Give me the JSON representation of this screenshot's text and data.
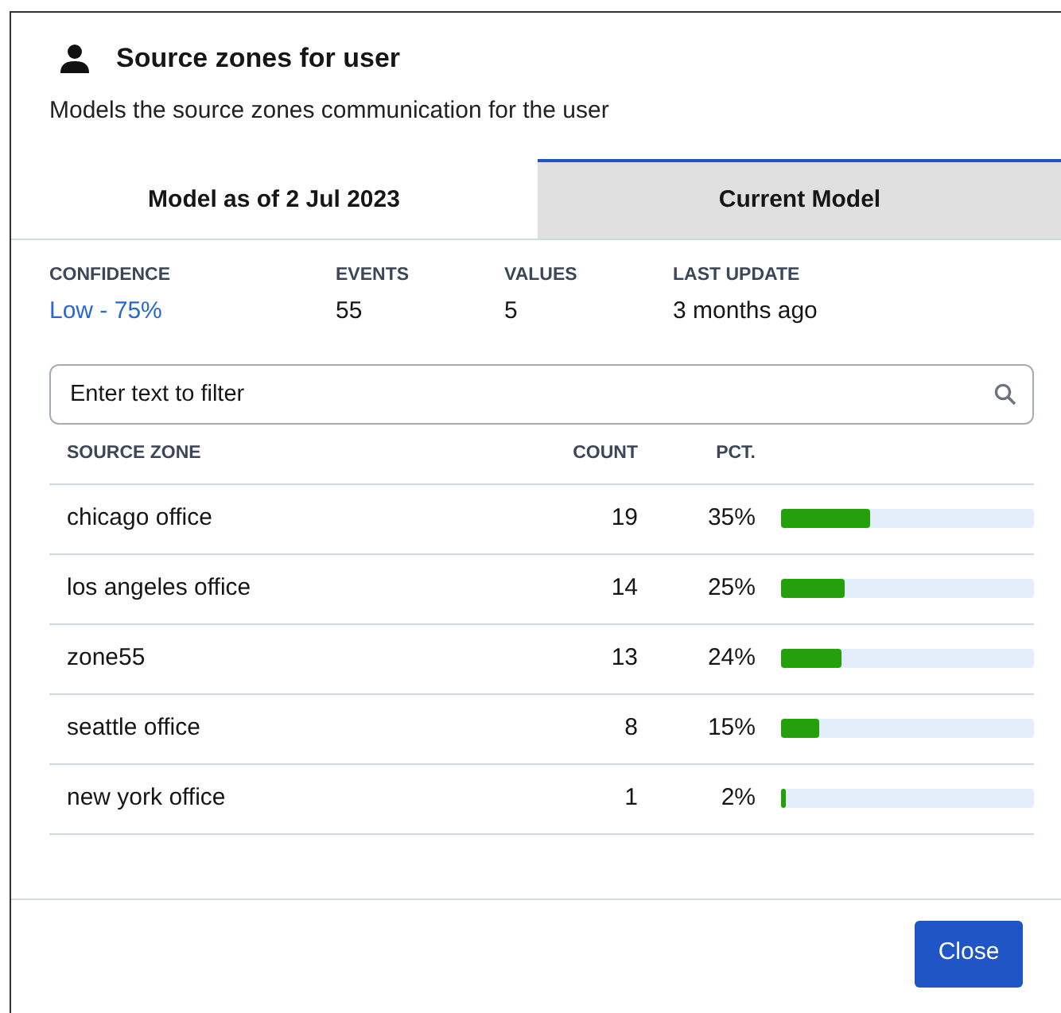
{
  "dialog": {
    "title": "Source zones for user",
    "description": "Models the source zones communication for the user"
  },
  "tabs": [
    {
      "label": "Model as of 2 Jul 2023",
      "selected": false
    },
    {
      "label": "Current Model",
      "selected": true
    }
  ],
  "stats": [
    {
      "label": "CONFIDENCE",
      "value": "Low - 75%",
      "kind": "link"
    },
    {
      "label": "EVENTS",
      "value": "55",
      "kind": "plain"
    },
    {
      "label": "VALUES",
      "value": "5",
      "kind": "plain"
    },
    {
      "label": "LAST UPDATE",
      "value": "3 months ago",
      "kind": "plain"
    }
  ],
  "filter": {
    "placeholder": "Enter text to filter"
  },
  "table": {
    "columns": [
      "SOURCE ZONE",
      "COUNT",
      "PCT."
    ],
    "rows": [
      {
        "zone": "chicago office",
        "count": "19",
        "pct": "35%",
        "level": 0.35
      },
      {
        "zone": "los angeles office",
        "count": "14",
        "pct": "25%",
        "level": 0.25
      },
      {
        "zone": "zone55",
        "count": "13",
        "pct": "24%",
        "level": 0.24
      },
      {
        "zone": "seattle office",
        "count": "8",
        "pct": "15%",
        "level": 0.15
      },
      {
        "zone": "new york office",
        "count": "1",
        "pct": "2%",
        "level": 0.02
      }
    ]
  },
  "buttons": [
    {
      "label": "Close"
    }
  ]
}
